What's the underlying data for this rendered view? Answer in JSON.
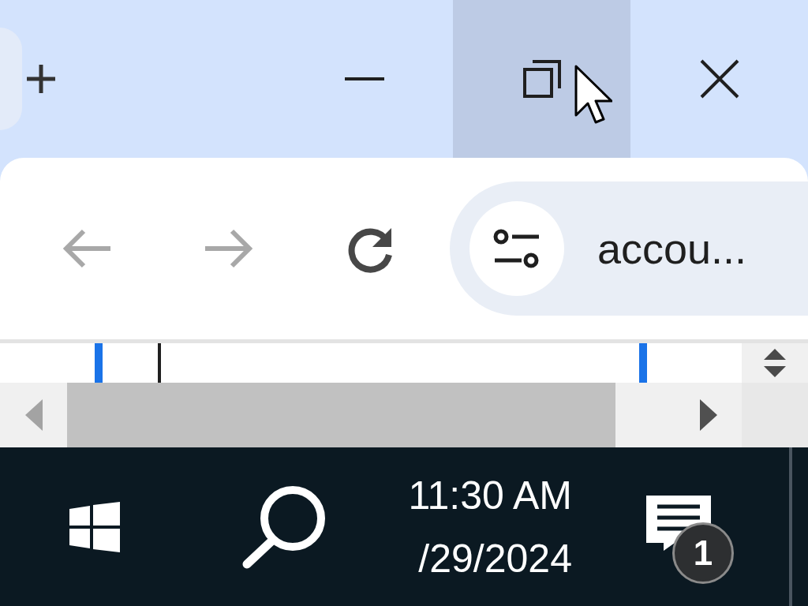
{
  "window_controls": [
    {
      "kind": "minimize",
      "hovered": false
    },
    {
      "kind": "restore",
      "hovered": true
    },
    {
      "kind": "close",
      "hovered": false
    }
  ],
  "nav_buttons": [
    {
      "kind": "back",
      "disabled": true
    },
    {
      "kind": "forward",
      "disabled": true
    },
    {
      "kind": "reload",
      "disabled": false
    }
  ],
  "address_bar": {
    "value": "accou..."
  },
  "taskbar": {
    "time": "11:30 AM",
    "date": "/29/2024",
    "notification_badge": "1"
  }
}
